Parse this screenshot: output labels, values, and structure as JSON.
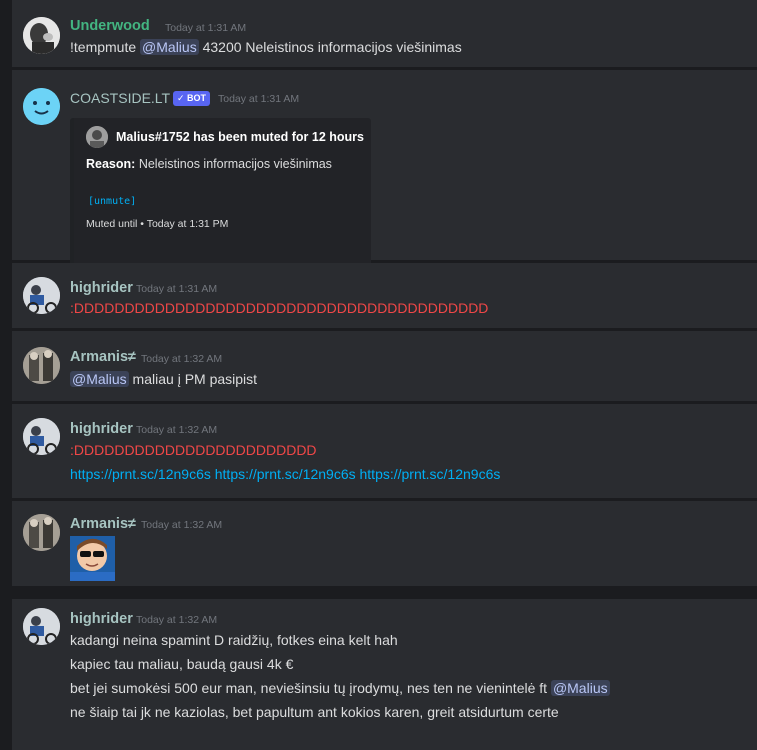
{
  "messages": {
    "m1": {
      "user": "Underwood",
      "user_color": "#43b581",
      "time": "Today at 1:31 AM",
      "text_prefix": "!tempmute ",
      "mention": "@Malius",
      "text_suffix": " 43200 Neleistinos informacijos viešinimas"
    },
    "m2": {
      "user": "COASTSIDE.LT",
      "bot_badge": "✓ BOT",
      "time": "Today at 1:31 AM",
      "embed": {
        "title": "Malius#1752 has been muted for 12 hours",
        "reason_label": "Reason:",
        "reason": "Neleistinos informacijos viešinimas",
        "action": "[unmute]",
        "footer_prefix": "Muted until",
        "footer_dot": "•",
        "footer_time": "Today at 1:31 PM"
      }
    },
    "m3": {
      "user": "highrider",
      "time": "Today at 1:31 AM",
      "text": ":DDDDDDDDDDDDDDDDDDDDDDDDDDDDDDDDDDDDDDDDD"
    },
    "m4": {
      "user": "Armanis≠",
      "time": "Today at 1:32 AM",
      "mention": "@Malius",
      "text_suffix": " maliau į PM pasipist"
    },
    "m5": {
      "user": "highrider",
      "time": "Today at 1:32 AM",
      "text": ":DDDDDDDDDDDDDDDDDDDDDDDD",
      "links": [
        "https://prnt.sc/12n9c6s",
        "https://prnt.sc/12n9c6s",
        "https://prnt.sc/12n9c6s"
      ]
    },
    "m6": {
      "user": "Armanis≠",
      "time": "Today at 1:32 AM"
    },
    "m7": {
      "user": "highrider",
      "time": "Today at 1:32 AM",
      "line1": "kadangi neina spamint D raidžių, fotkes eina kelt hah",
      "line2": "kapiec tau maliau, baudą gausi 4k €",
      "line3": "bet jei sumokėsi 500 eur man, neviešinsiu tų įrodymų, nes ten ne vienintelė ft ",
      "line3_mention": "@Malius",
      "line4": "ne šiaip tai jk ne kaziolas, bet papultum ant kokios karen, greit atsidurtum certe"
    }
  },
  "colors": {
    "background": "#1b1c1f",
    "message_bg": "#2a2c30",
    "green_user": "#43b581",
    "default_user": "#a7c4c1",
    "link": "#00aff4",
    "red_text": "#f04747",
    "bot_badge": "#5865f2"
  }
}
